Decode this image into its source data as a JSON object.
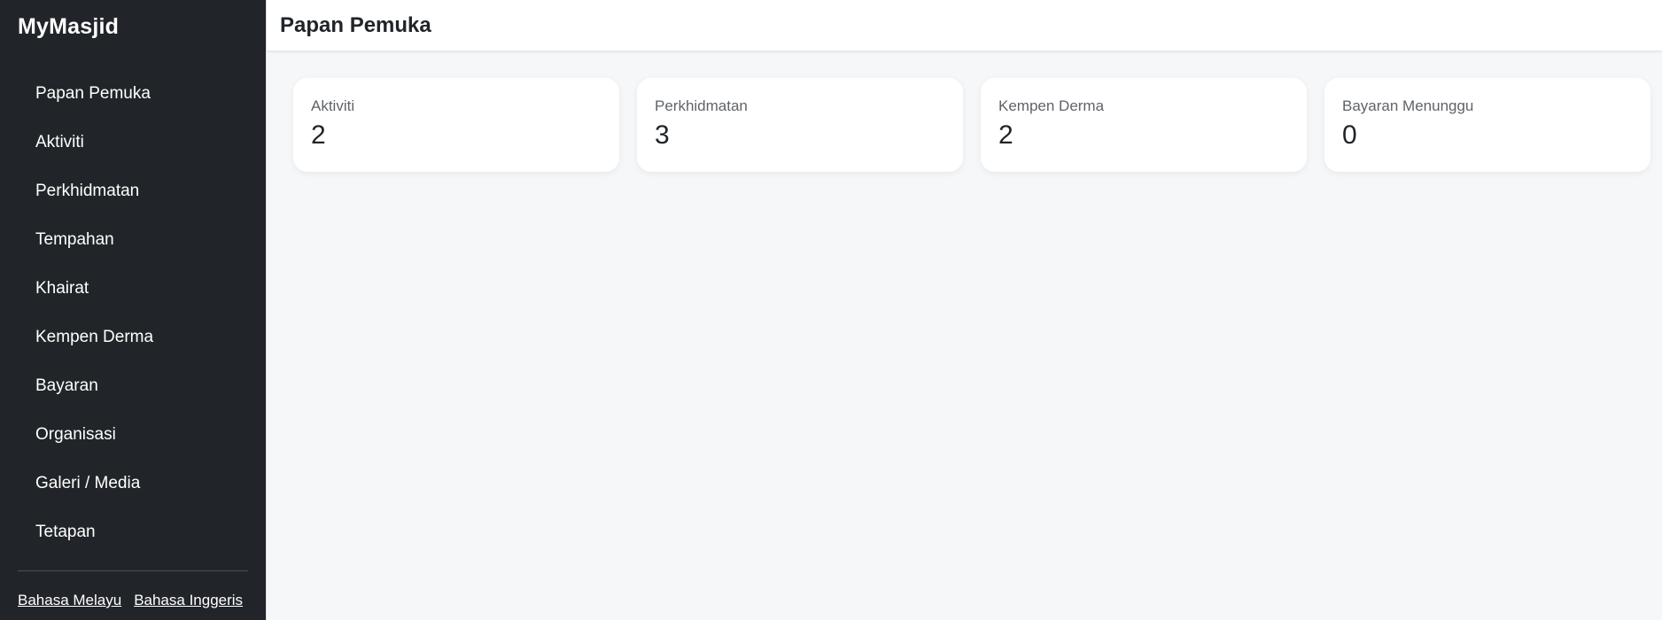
{
  "app": {
    "brand": "MyMasjid"
  },
  "sidebar": {
    "items": [
      {
        "label": "Papan Pemuka"
      },
      {
        "label": "Aktiviti"
      },
      {
        "label": "Perkhidmatan"
      },
      {
        "label": "Tempahan"
      },
      {
        "label": "Khairat"
      },
      {
        "label": "Kempen Derma"
      },
      {
        "label": "Bayaran"
      },
      {
        "label": "Organisasi"
      },
      {
        "label": "Galeri / Media"
      },
      {
        "label": "Tetapan"
      }
    ],
    "languages": [
      {
        "label": "Bahasa Melayu"
      },
      {
        "label": "Bahasa Inggeris"
      }
    ]
  },
  "header": {
    "title": "Papan Pemuka"
  },
  "stats": [
    {
      "label": "Aktiviti",
      "value": "2"
    },
    {
      "label": "Perkhidmatan",
      "value": "3"
    },
    {
      "label": "Kempen Derma",
      "value": "2"
    },
    {
      "label": "Bayaran Menunggu",
      "value": "0"
    }
  ],
  "colors": {
    "sidebar_bg": "#212529",
    "main_bg": "#f5f7f9",
    "card_bg": "#ffffff",
    "text_dark": "#212529",
    "text_muted": "#5f6368"
  }
}
